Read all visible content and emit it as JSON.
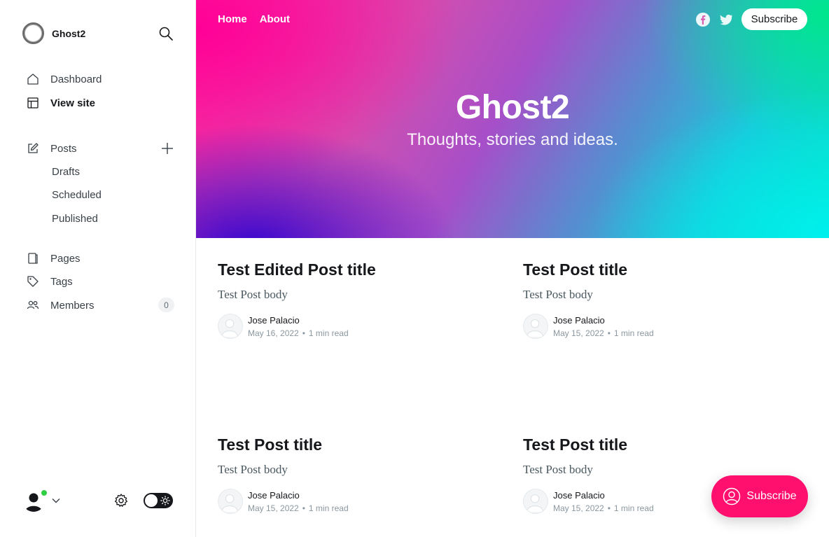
{
  "sidebar": {
    "brand_name": "Ghost2",
    "nav": {
      "dashboard": "Dashboard",
      "view_site": "View site",
      "posts": "Posts",
      "drafts": "Drafts",
      "scheduled": "Scheduled",
      "published": "Published",
      "pages": "Pages",
      "tags": "Tags",
      "members": "Members",
      "members_count": "0"
    }
  },
  "site": {
    "nav": [
      "Home",
      "About"
    ],
    "subscribe_label": "Subscribe",
    "title": "Ghost2",
    "description": "Thoughts, stories and ideas.",
    "portal_label": "Subscribe",
    "accent_color": "#ff0f6e",
    "posts": [
      {
        "title": "Test Edited Post title",
        "excerpt": "Test Post body",
        "author": "Jose Palacio",
        "date": "May 16, 2022",
        "reading_time": "1 min read"
      },
      {
        "title": "Test Post title",
        "excerpt": "Test Post body",
        "author": "Jose Palacio",
        "date": "May 15, 2022",
        "reading_time": "1 min read"
      },
      {
        "title": "Test Post title",
        "excerpt": "Test Post body",
        "author": "Jose Palacio",
        "date": "May 15, 2022",
        "reading_time": "1 min read"
      },
      {
        "title": "Test Post title",
        "excerpt": "Test Post body",
        "author": "Jose Palacio",
        "date": "May 15, 2022",
        "reading_time": "1 min read"
      }
    ]
  },
  "icons": {
    "social": [
      "facebook-icon",
      "twitter-icon"
    ],
    "sidebar": [
      "search-icon",
      "home-icon",
      "view-site-icon",
      "posts-icon",
      "plus-icon",
      "pages-icon",
      "tags-icon",
      "members-icon",
      "settings-icon",
      "sun-icon"
    ]
  },
  "status": {
    "online_color": "#30cf43"
  }
}
